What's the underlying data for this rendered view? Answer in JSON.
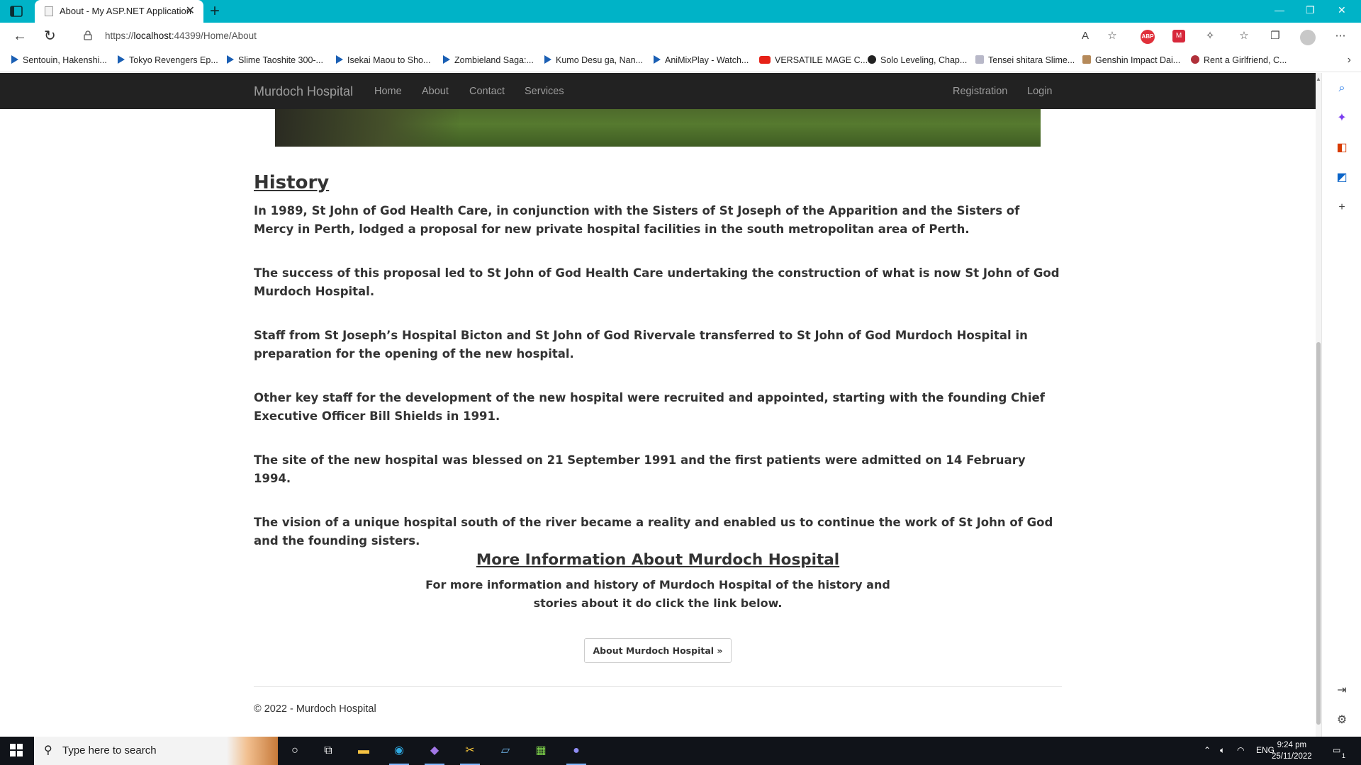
{
  "browser": {
    "tab_title": "About - My ASP.NET Application",
    "tab_close": "✕",
    "new_tab": "+",
    "url_prefix": "https://",
    "url_host": "localhost",
    "url_rest": ":44399/Home/About",
    "window_controls": [
      "—",
      "❐",
      "✕"
    ],
    "bookmarks": [
      {
        "label": "Sentouin, Hakenshi...",
        "icon": "play"
      },
      {
        "label": "Tokyo Revengers Ep...",
        "icon": "play"
      },
      {
        "label": "Slime Taoshite 300-...",
        "icon": "play"
      },
      {
        "label": "Isekai Maou to Sho...",
        "icon": "play"
      },
      {
        "label": "Zombieland Saga:...",
        "icon": "play"
      },
      {
        "label": "Kumo Desu ga, Nan...",
        "icon": "play"
      },
      {
        "label": "AniMixPlay - Watch...",
        "icon": "play"
      },
      {
        "label": "VERSATILE MAGE C...",
        "icon": "yt"
      },
      {
        "label": "Solo Leveling, Chap...",
        "icon": "dark"
      },
      {
        "label": "Tensei shitara Slime...",
        "icon": "pale"
      },
      {
        "label": "Genshin Impact Dai...",
        "icon": "gi"
      },
      {
        "label": "Rent a Girlfriend, C...",
        "icon": "rg"
      }
    ],
    "abp_label": "ABP"
  },
  "site": {
    "brand": "Murdoch Hospital",
    "nav_left": [
      "Home",
      "About",
      "Contact",
      "Services"
    ],
    "nav_right": [
      "Registration",
      "Login"
    ]
  },
  "history": {
    "heading": "History",
    "paragraphs": [
      "In 1989, St John of God Health Care, in conjunction with the Sisters of St Joseph of the Apparition and the Sisters of Mercy in Perth, lodged a proposal for new private hospital facilities in the south metropolitan area of Perth.",
      "The success of this proposal led to St John of God Health Care undertaking the construction of what is now St John of God Murdoch Hospital.",
      "Staff from St Joseph’s Hospital Bicton and St John of God Rivervale transferred to St John of God Murdoch Hospital in preparation for the opening of the new hospital.",
      "Other key staff for the development of the new hospital were recruited and appointed, starting with the founding Chief Executive Officer Bill Shields in 1991.",
      "The site of the new hospital was blessed on 21 September 1991 and the first patients were admitted on 14 February 1994.",
      "The vision of a unique hospital south of the river became a reality and enabled us to continue the work of St John of God and the founding sisters."
    ]
  },
  "more_info": {
    "heading": "More Information About Murdoch Hospital",
    "text": "For more information and history of Murdoch Hospital of the history and stories about it do click the link below.",
    "button": "About Murdoch Hospital »"
  },
  "footer": {
    "text": "© 2022 - Murdoch Hospital"
  },
  "taskbar": {
    "search_placeholder": "Type here to search",
    "language": "ENG",
    "time": "9:24 pm",
    "date": "25/11/2022",
    "notification_count": "1"
  },
  "colors": {
    "tabstrip": "#00b3c7",
    "site_nav": "#222222",
    "nav_text": "#9d9d9d",
    "taskbar": "#101319"
  }
}
